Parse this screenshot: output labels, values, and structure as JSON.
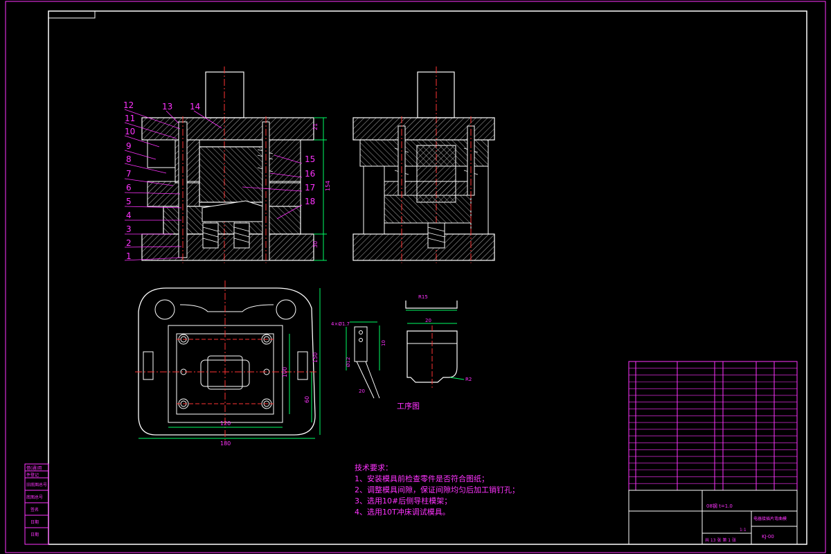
{
  "drawing": {
    "part_numbers": [
      "12",
      "11",
      "10",
      "9",
      "8",
      "7",
      "6",
      "5",
      "4",
      "3",
      "2",
      "1"
    ],
    "part_numbers_top": [
      "13",
      "14"
    ],
    "part_numbers_right": [
      "15",
      "16",
      "17",
      "18"
    ],
    "dims_left_view": {
      "total_height": "154",
      "top": "21",
      "bottom": "30"
    },
    "dims_plan": {
      "width": "180",
      "inner_width": "120",
      "height": "150",
      "inner_height": "100",
      "offset": "60"
    },
    "process_label": "工序图",
    "part_dims": {
      "r": "R15",
      "w": "20",
      "r2": "R2",
      "holes": "4×Ø1.7",
      "d1": "Ø12",
      "d2": "10",
      "d3": "20"
    },
    "colors": {
      "bg": "#000000",
      "outline": "#ffffff",
      "center": "#ff3333",
      "dim": "#00ff66",
      "label": "#ff33ff",
      "hatch": "#ffffff",
      "cyan": "#00ffff"
    }
  },
  "tech_requirements": {
    "title": "技术要求：",
    "items": [
      "1、安装模具前检查零件是否符合图纸；",
      "2、调整模具间隙，保证间隙均匀后加工销钉孔；",
      "3、选用10#后侧导柱模架；",
      "4、选用10T冲床调试模具。"
    ]
  },
  "title_block": {
    "material_line": "08钢 t=1.0",
    "part_name": "电器接插片弯曲模",
    "drawing_no": "KJ-00",
    "scale": "1:1",
    "sheet": "共 13 张   第 1 张"
  },
  "left_strip": [
    "借(通)用",
    "件登记",
    "旧底图总号",
    "底图总号",
    "签名",
    "日期",
    "日期"
  ]
}
